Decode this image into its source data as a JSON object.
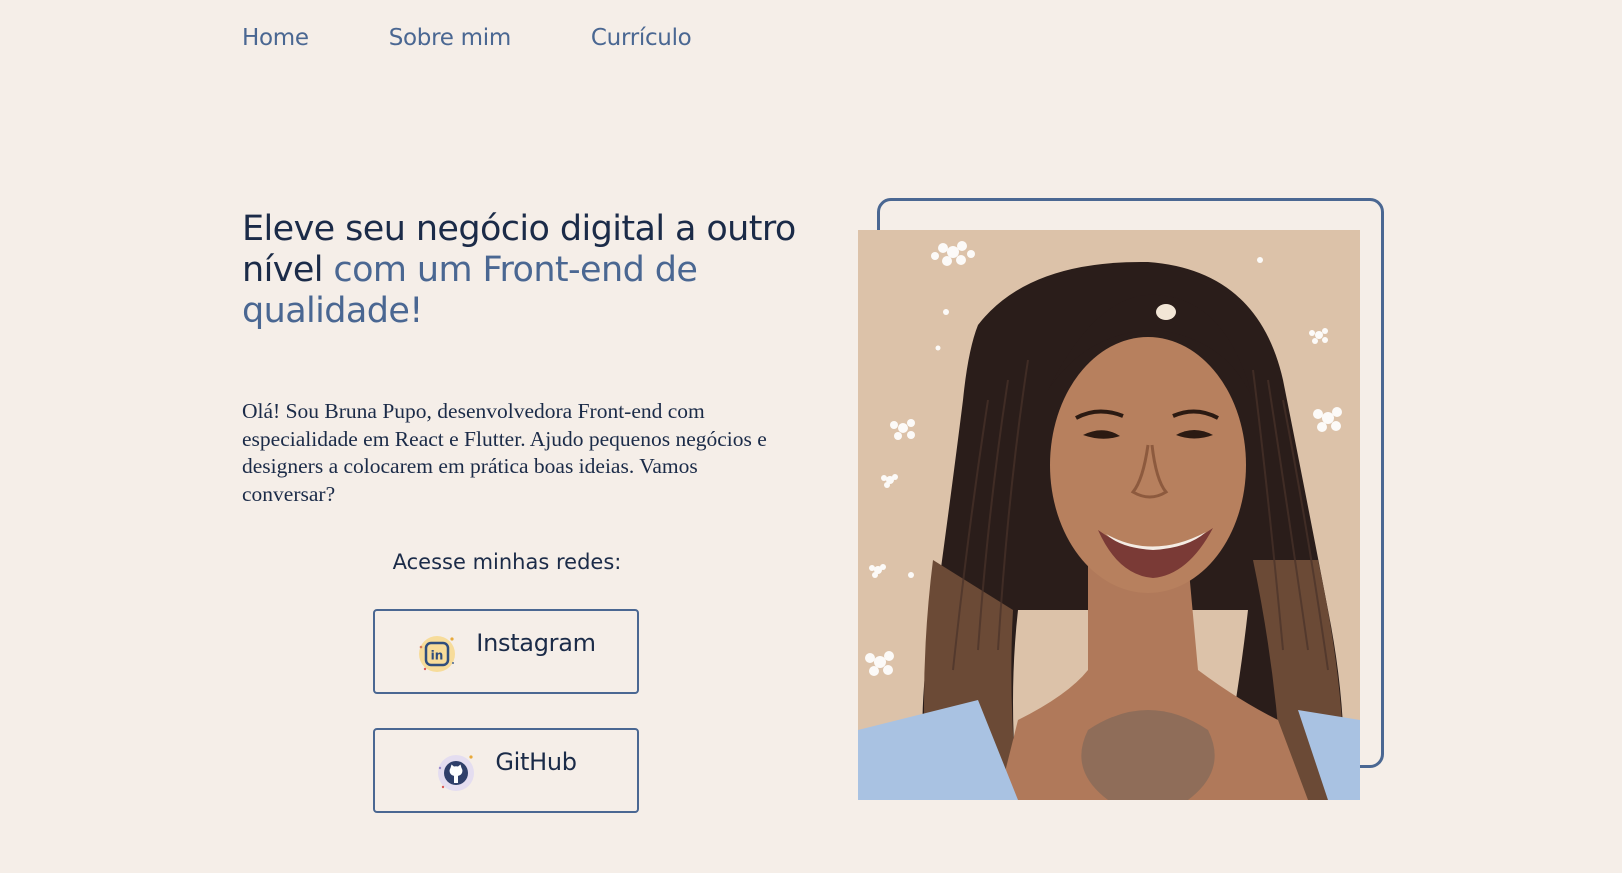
{
  "nav": {
    "items": [
      {
        "label": "Home"
      },
      {
        "label": "Sobre mim"
      },
      {
        "label": "Currículo"
      }
    ]
  },
  "hero": {
    "headline_main": "Eleve seu negócio digital a outro nível",
    "headline_accent": "com um Front-end de qualidade!",
    "intro": "Olá! Sou Bruna Pupo, desenvolvedora Front-end com especialidade em React e Flutter. Ajudo pequenos negócios e designers a colocarem em prática boas ideias. Vamos conversar?"
  },
  "social": {
    "title": "Acesse minhas redes:",
    "buttons": [
      {
        "label": "Instagram",
        "icon": "linkedin-icon"
      },
      {
        "label": "GitHub",
        "icon": "github-icon"
      }
    ]
  },
  "colors": {
    "background": "#f5eee8",
    "primary": "#1b2b48",
    "accent": "#4a6792",
    "photo_background": "#dcc2a9"
  }
}
